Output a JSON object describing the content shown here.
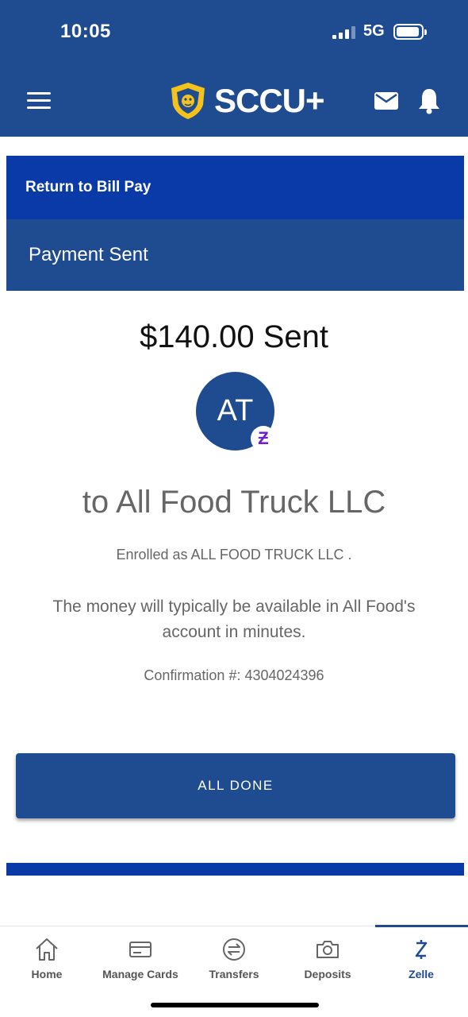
{
  "status_bar": {
    "time": "10:05",
    "network": "5G"
  },
  "header": {
    "logo_text": "SCCU+"
  },
  "return_link": "Return to Bill Pay",
  "section_title": "Payment Sent",
  "payment": {
    "amount_text": "$140.00 Sent",
    "avatar_initials": "AT",
    "recipient_text": "to All Food Truck LLC",
    "enrolled_text": "Enrolled as ALL FOOD TRUCK LLC .",
    "availability_text": "The money will typically be available in All Food's account in minutes.",
    "confirmation_text": "Confirmation #: 4304024396"
  },
  "done_button": "ALL DONE",
  "tabs": [
    {
      "label": "Home",
      "icon": "home-icon"
    },
    {
      "label": "Manage Cards",
      "icon": "card-icon"
    },
    {
      "label": "Transfers",
      "icon": "transfer-icon"
    },
    {
      "label": "Deposits",
      "icon": "camera-icon"
    },
    {
      "label": "Zelle",
      "icon": "zelle-icon",
      "active": true
    }
  ],
  "colors": {
    "brand_blue": "#1f4b91",
    "link_bar_blue": "#0a3aa8",
    "zelle_purple": "#6d1ed4",
    "shield_yellow": "#f4c21b"
  }
}
